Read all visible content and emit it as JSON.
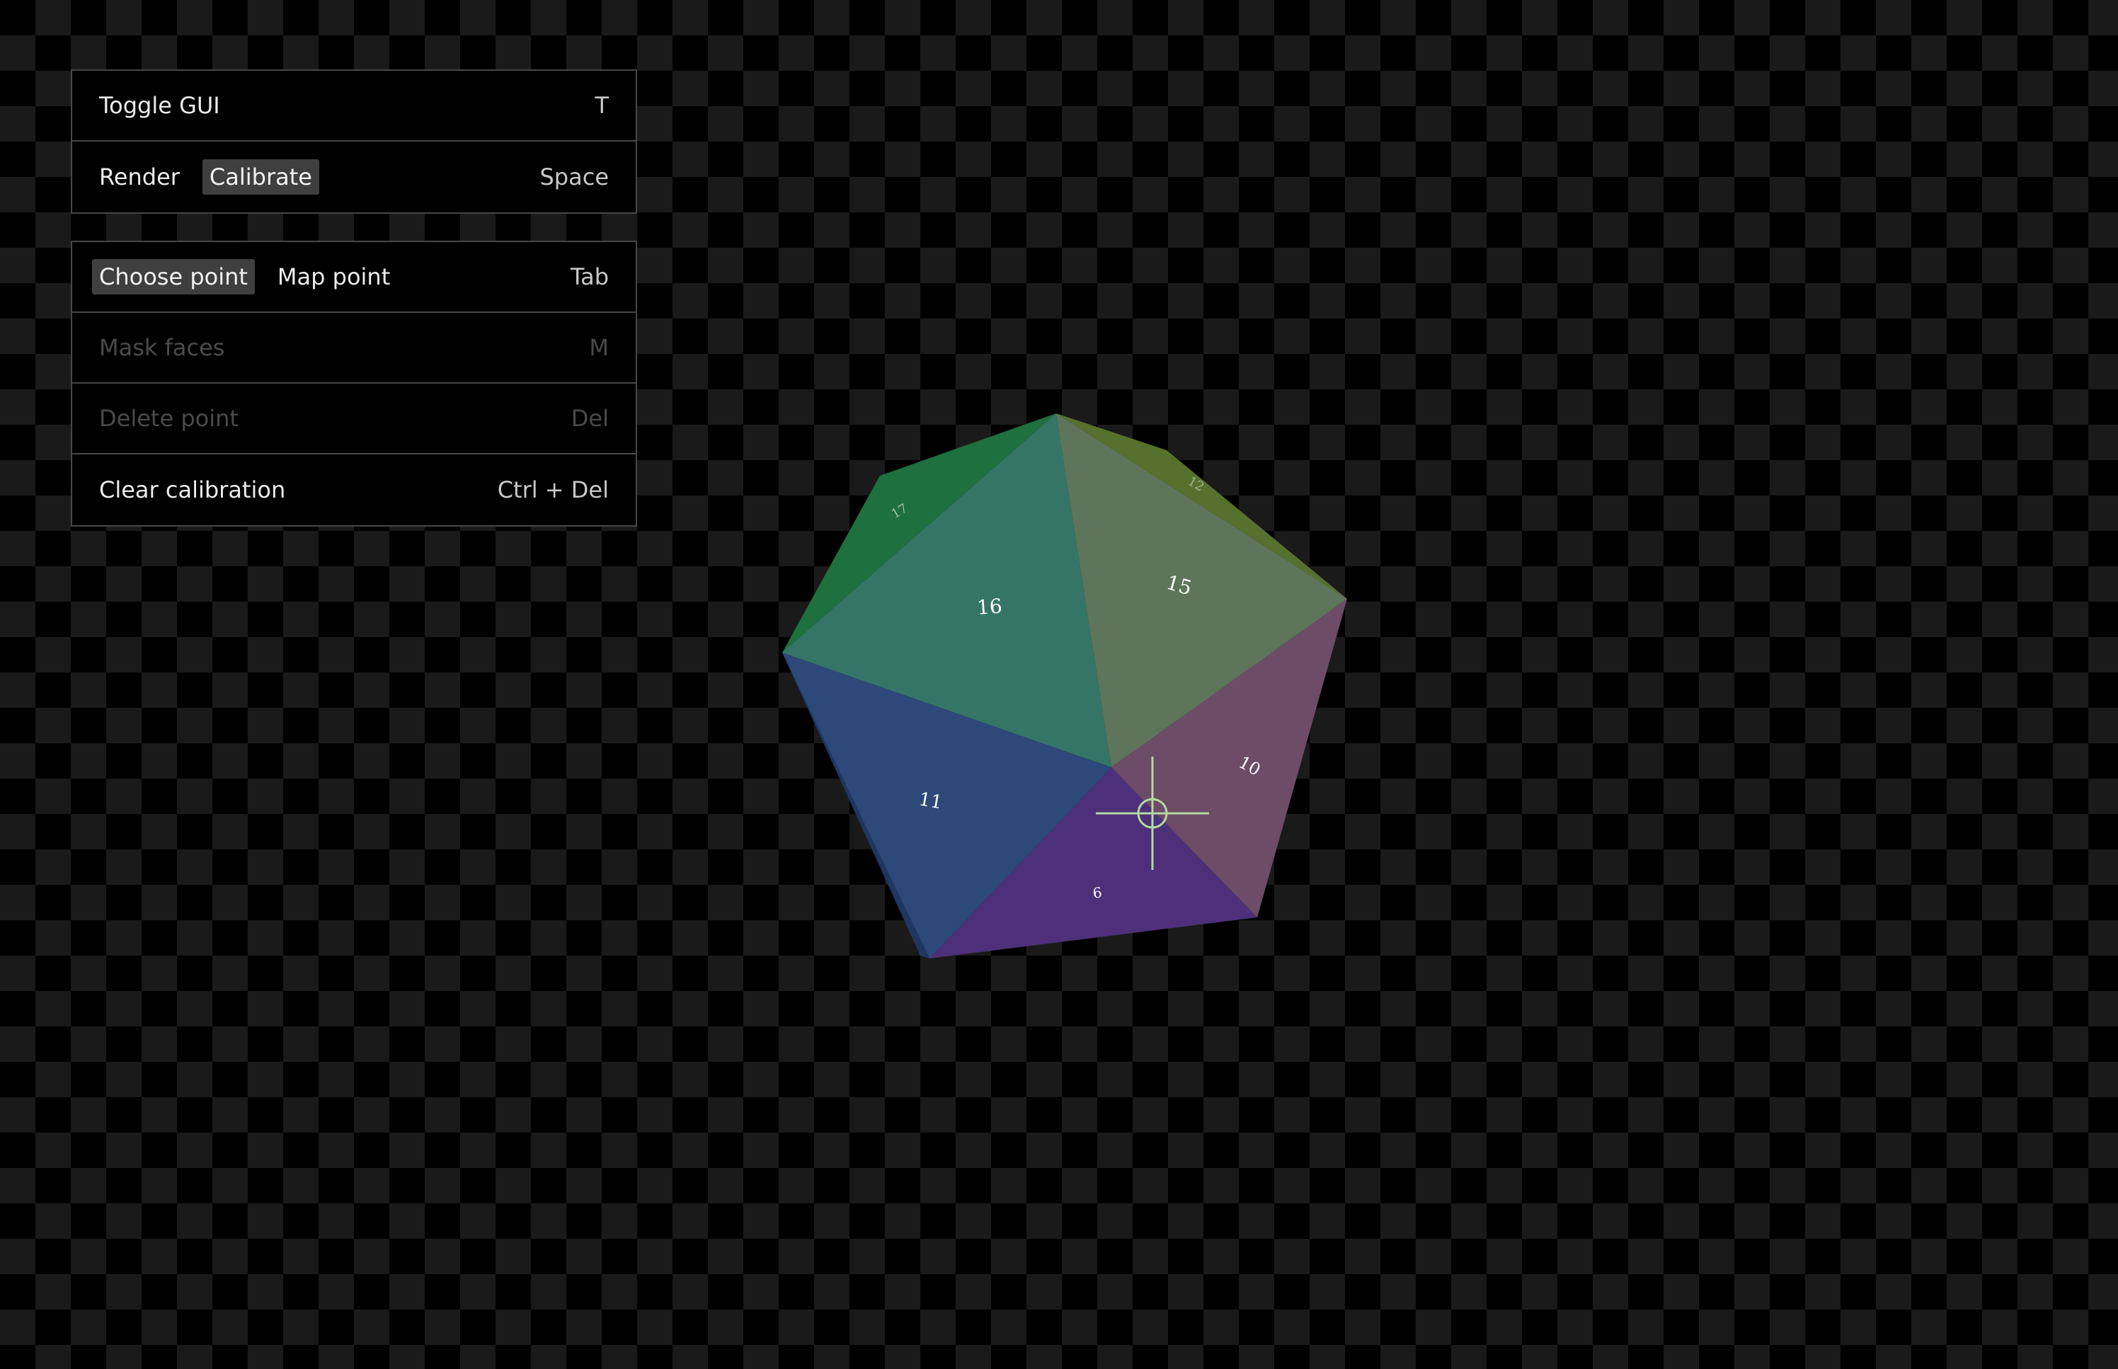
{
  "gui": {
    "toggle_gui": {
      "label": "Toggle GUI",
      "shortcut": "T"
    },
    "mode": {
      "options": [
        "Render",
        "Calibrate"
      ],
      "selected": "Calibrate",
      "shortcut": "Space"
    }
  },
  "calibration": {
    "point_mode": {
      "options": [
        "Choose point",
        "Map point"
      ],
      "selected": "Choose point",
      "shortcut": "Tab"
    },
    "mask_faces": {
      "label": "Mask faces",
      "shortcut": "M",
      "enabled": false
    },
    "delete_point": {
      "label": "Delete point",
      "shortcut": "Del",
      "enabled": false
    },
    "clear_calibration": {
      "label": "Clear calibration",
      "shortcut": "Ctrl + Del"
    }
  },
  "model": {
    "faces": [
      {
        "number": "16",
        "color": "#357568"
      },
      {
        "number": "15",
        "color": "#5f755b"
      },
      {
        "number": "10",
        "color": "#6d4c68"
      },
      {
        "number": "6",
        "color": "#4d3079"
      },
      {
        "number": "11",
        "color": "#2d4979"
      },
      {
        "number": "17",
        "color": "#1e703e"
      },
      {
        "number": "12",
        "color": "#56712e"
      }
    ],
    "crosshair_color": "#b5d9a0"
  }
}
